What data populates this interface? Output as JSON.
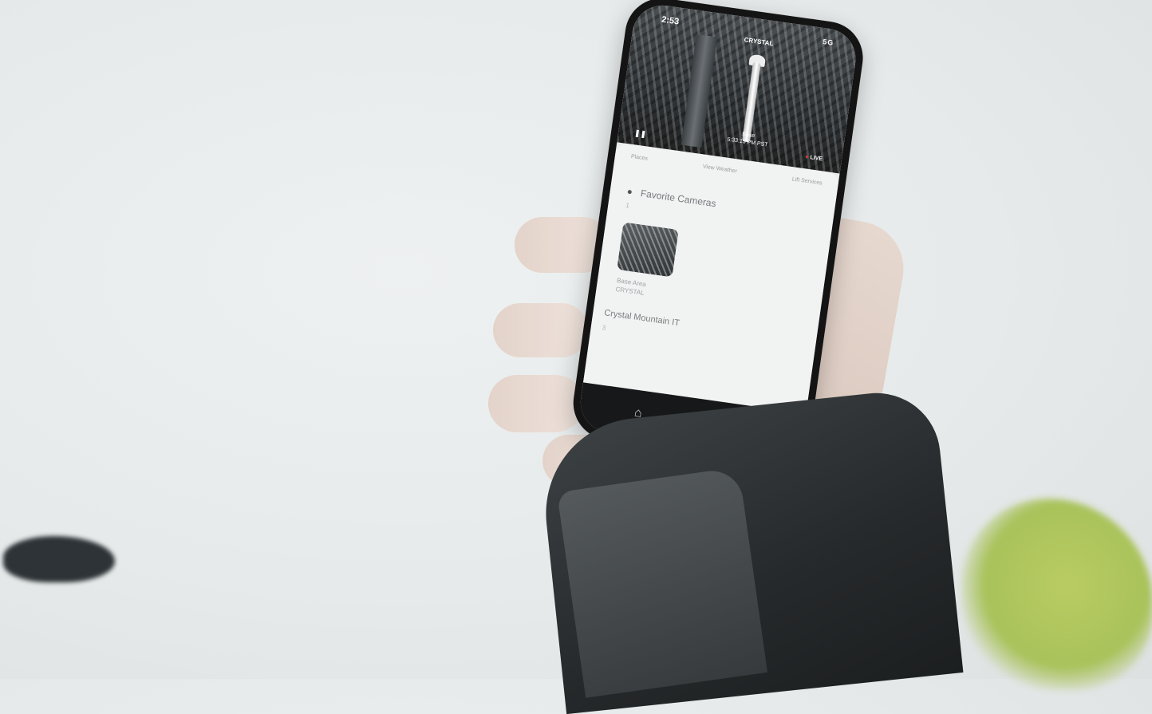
{
  "status_bar": {
    "time": "2:53",
    "signal": "5G"
  },
  "camera": {
    "name": "CRYSTAL",
    "caption_line1": "Base",
    "caption_line2": "5:33:15 PM PST",
    "live_label": "LIVE"
  },
  "tabs": [
    {
      "label": "Places"
    },
    {
      "label": "View Weather"
    },
    {
      "label": "Lift Services"
    }
  ],
  "favorites": {
    "title": "Favorite Cameras",
    "count": "1",
    "item_label_line1": "Base Area",
    "item_label_line2": "CRYSTAL"
  },
  "group": {
    "title": "Crystal Mountain IT",
    "count": "3"
  },
  "bottom_nav": [
    {
      "icon": "home-icon",
      "glyph": "⌂"
    },
    {
      "icon": "search-icon",
      "glyph": "⌕"
    },
    {
      "icon": "bell-icon",
      "glyph": "🔔︎"
    }
  ]
}
